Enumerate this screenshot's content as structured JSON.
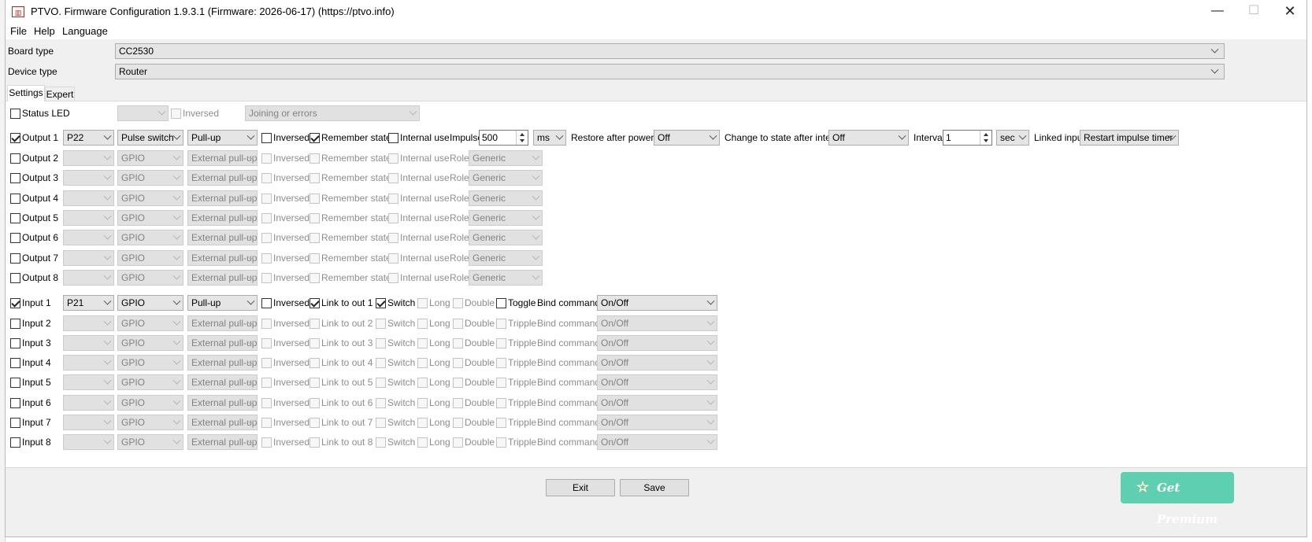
{
  "window": {
    "title": "PTVO. Firmware Configuration 1.9.3.1 (Firmware: 2026-06-17) (https://ptvo.info)",
    "icon_text": "PTVO",
    "minimize": "—",
    "maximize": "☐",
    "close": "✕"
  },
  "menu": [
    "File",
    "Help",
    "Language"
  ],
  "board": {
    "label": "Board type",
    "value": "CC2530"
  },
  "device": {
    "label": "Device type",
    "value": "Router"
  },
  "tabs": [
    "Settings",
    "Expert"
  ],
  "status_led": {
    "label": "Status LED",
    "pin": "",
    "inversed_label": "Inversed",
    "mode": "Joining or errors"
  },
  "output_active": {
    "label": "Output 1",
    "pin": "P22",
    "mode": "Pulse switch",
    "pull": "Pull-up",
    "inversed": "Inversed",
    "remember": "Remember state",
    "internal": "Internal use",
    "impulse_label": "Impulse",
    "impulse_value": "500",
    "impulse_unit": "ms",
    "restore_label": "Restore after power off",
    "restore_value": "Off",
    "change_label": "Change to state after interval",
    "change_value": "Off",
    "interval_label": "Interval",
    "interval_value": "1",
    "interval_unit": "sec",
    "linked_label": "Linked input",
    "linked_value": "Restart impulse timer"
  },
  "outputs": [
    {
      "label": "Output 2",
      "mode": "GPIO",
      "pull": "External pull-up",
      "inversed": "Inversed",
      "remember": "Remember state",
      "internal": "Internal use",
      "role_label": "Role",
      "role": "Generic"
    },
    {
      "label": "Output 3",
      "mode": "GPIO",
      "pull": "External pull-up",
      "inversed": "Inversed",
      "remember": "Remember state",
      "internal": "Internal use",
      "role_label": "Role",
      "role": "Generic"
    },
    {
      "label": "Output 4",
      "mode": "GPIO",
      "pull": "External pull-up",
      "inversed": "Inversed",
      "remember": "Remember state",
      "internal": "Internal use",
      "role_label": "Role",
      "role": "Generic"
    },
    {
      "label": "Output 5",
      "mode": "GPIO",
      "pull": "External pull-up",
      "inversed": "Inversed",
      "remember": "Remember state",
      "internal": "Internal use",
      "role_label": "Role",
      "role": "Generic"
    },
    {
      "label": "Output 6",
      "mode": "GPIO",
      "pull": "External pull-up",
      "inversed": "Inversed",
      "remember": "Remember state",
      "internal": "Internal use",
      "role_label": "Role",
      "role": "Generic"
    },
    {
      "label": "Output 7",
      "mode": "GPIO",
      "pull": "External pull-up",
      "inversed": "Inversed",
      "remember": "Remember state",
      "internal": "Internal use",
      "role_label": "Role",
      "role": "Generic"
    },
    {
      "label": "Output 8",
      "mode": "GPIO",
      "pull": "External pull-up",
      "inversed": "Inversed",
      "remember": "Remember state",
      "internal": "Internal use",
      "role_label": "Role",
      "role": "Generic"
    }
  ],
  "input_active": {
    "label": "Input 1",
    "pin": "P21",
    "mode": "GPIO",
    "pull": "Pull-up",
    "inversed": "Inversed",
    "link": "Link to out 1",
    "switch": "Switch",
    "long": "Long",
    "double": "Double",
    "third": "Toggle",
    "bind_label": "Bind command",
    "bind_value": "On/Off"
  },
  "inputs": [
    {
      "label": "Input 2",
      "mode": "GPIO",
      "pull": "External pull-up",
      "inversed": "Inversed",
      "link": "Link to out 2",
      "switch": "Switch",
      "long": "Long",
      "double": "Double",
      "third": "Tripple",
      "bind_label": "Bind command",
      "bind_value": "On/Off"
    },
    {
      "label": "Input 3",
      "mode": "GPIO",
      "pull": "External pull-up",
      "inversed": "Inversed",
      "link": "Link to out 3",
      "switch": "Switch",
      "long": "Long",
      "double": "Double",
      "third": "Tripple",
      "bind_label": "Bind command",
      "bind_value": "On/Off"
    },
    {
      "label": "Input 4",
      "mode": "GPIO",
      "pull": "External pull-up",
      "inversed": "Inversed",
      "link": "Link to out 4",
      "switch": "Switch",
      "long": "Long",
      "double": "Double",
      "third": "Tripple",
      "bind_label": "Bind command",
      "bind_value": "On/Off"
    },
    {
      "label": "Input 5",
      "mode": "GPIO",
      "pull": "External pull-up",
      "inversed": "Inversed",
      "link": "Link to out 5",
      "switch": "Switch",
      "long": "Long",
      "double": "Double",
      "third": "Tripple",
      "bind_label": "Bind command",
      "bind_value": "On/Off"
    },
    {
      "label": "Input 6",
      "mode": "GPIO",
      "pull": "External pull-up",
      "inversed": "Inversed",
      "link": "Link to out 6",
      "switch": "Switch",
      "long": "Long",
      "double": "Double",
      "third": "Tripple",
      "bind_label": "Bind command",
      "bind_value": "On/Off"
    },
    {
      "label": "Input 7",
      "mode": "GPIO",
      "pull": "External pull-up",
      "inversed": "Inversed",
      "link": "Link to out 7",
      "switch": "Switch",
      "long": "Long",
      "double": "Double",
      "third": "Tripple",
      "bind_label": "Bind command",
      "bind_value": "On/Off"
    },
    {
      "label": "Input 8",
      "mode": "GPIO",
      "pull": "External pull-up",
      "inversed": "Inversed",
      "link": "Link to out 8",
      "switch": "Switch",
      "long": "Long",
      "double": "Double",
      "third": "Tripple",
      "bind_label": "Bind command",
      "bind_value": "On/Off"
    }
  ],
  "buttons": {
    "exit": "Exit",
    "save": "Save",
    "premium": "Get Premium"
  },
  "colors": {
    "premium": "#5ecfb0",
    "disabled_text": "#8d8d8d"
  }
}
